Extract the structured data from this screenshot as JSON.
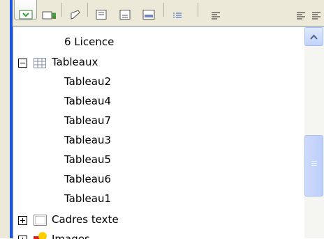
{
  "navigator": {
    "items": [
      {
        "label": "6 Licence"
      },
      {
        "label": "Tableaux"
      },
      {
        "label": "Tableau2"
      },
      {
        "label": "Tableau4"
      },
      {
        "label": "Tableau7"
      },
      {
        "label": "Tableau3"
      },
      {
        "label": "Tableau5"
      },
      {
        "label": "Tableau6"
      },
      {
        "label": "Tableau1"
      },
      {
        "label": "Cadres texte"
      },
      {
        "label": "Images"
      }
    ]
  },
  "colors": {
    "window_frame": "#ece9d8",
    "accent_blue": "#1f55d8",
    "scroll_accent": "#c1d3fb"
  }
}
